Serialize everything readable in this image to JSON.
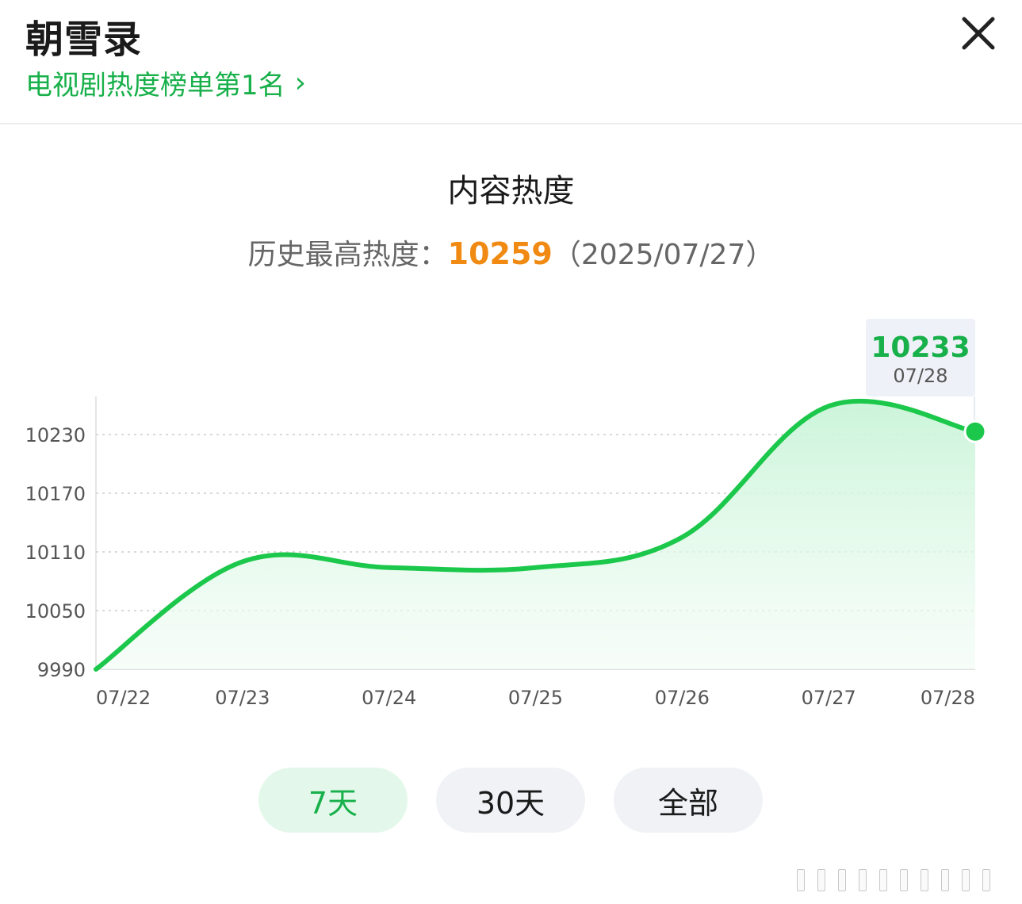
{
  "header": {
    "title": "朝雪录",
    "rank_link": "电视剧热度榜单第1名",
    "chevron_glyph": "›",
    "close_glyph": "✕"
  },
  "main": {
    "section_title": "内容热度",
    "peak_label": "历史最高热度：",
    "peak_value": "10259",
    "peak_date": "（2025/07/27）"
  },
  "tooltip": {
    "value": "10233",
    "date": "07/28"
  },
  "tabs": [
    {
      "label": "7天",
      "active": true
    },
    {
      "label": "30天",
      "active": false
    },
    {
      "label": "全部",
      "active": false
    }
  ],
  "colors": {
    "accent": "#18b04a",
    "line": "#1cc84b",
    "fill": "#dff8e8",
    "peak": "#f08a12"
  },
  "chart_data": {
    "type": "area",
    "categories": [
      "07/22",
      "07/23",
      "07/24",
      "07/25",
      "07/26",
      "07/27",
      "07/28"
    ],
    "values": [
      9990,
      10100,
      10094,
      10094,
      10125,
      10259,
      10233
    ],
    "y_ticks": [
      9990,
      10050,
      10110,
      10170,
      10230
    ],
    "ylim": [
      9990,
      10230
    ],
    "grid": true,
    "highlight_index": 6
  }
}
